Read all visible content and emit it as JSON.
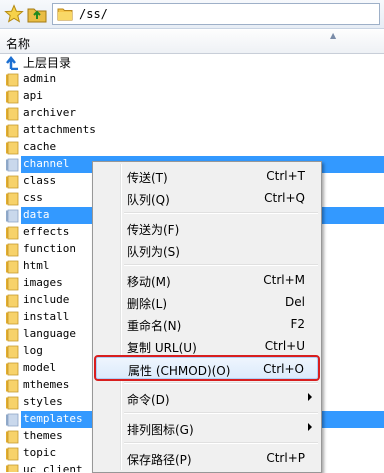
{
  "path_bar": {
    "path": "/ss/"
  },
  "column_header": {
    "name": "名称"
  },
  "files": [
    {
      "name": "上层目录",
      "kind": "parent",
      "selected": false
    },
    {
      "name": "admin",
      "kind": "folder",
      "selected": false
    },
    {
      "name": "api",
      "kind": "folder",
      "selected": false
    },
    {
      "name": "archiver",
      "kind": "folder",
      "selected": false
    },
    {
      "name": "attachments",
      "kind": "folder",
      "selected": false
    },
    {
      "name": "cache",
      "kind": "folder",
      "selected": false
    },
    {
      "name": "channel",
      "kind": "folder",
      "selected": true
    },
    {
      "name": "class",
      "kind": "folder",
      "selected": false
    },
    {
      "name": "css",
      "kind": "folder",
      "selected": false
    },
    {
      "name": "data",
      "kind": "folder",
      "selected": true
    },
    {
      "name": "effects",
      "kind": "folder",
      "selected": false
    },
    {
      "name": "function",
      "kind": "folder",
      "selected": false
    },
    {
      "name": "html",
      "kind": "folder",
      "selected": false
    },
    {
      "name": "images",
      "kind": "folder",
      "selected": false
    },
    {
      "name": "include",
      "kind": "folder",
      "selected": false
    },
    {
      "name": "install",
      "kind": "folder",
      "selected": false
    },
    {
      "name": "language",
      "kind": "folder",
      "selected": false
    },
    {
      "name": "log",
      "kind": "folder",
      "selected": false
    },
    {
      "name": "model",
      "kind": "folder",
      "selected": false
    },
    {
      "name": "mthemes",
      "kind": "folder",
      "selected": false
    },
    {
      "name": "styles",
      "kind": "folder",
      "selected": false
    },
    {
      "name": "templates",
      "kind": "folder",
      "selected": true
    },
    {
      "name": "themes",
      "kind": "folder",
      "selected": false
    },
    {
      "name": "topic",
      "kind": "folder",
      "selected": false
    },
    {
      "name": "uc_client",
      "kind": "folder",
      "selected": false
    }
  ],
  "context_menu": {
    "items": [
      {
        "label": "传送(T)",
        "shortcut": "Ctrl+T"
      },
      {
        "label": "队列(Q)",
        "shortcut": "Ctrl+Q"
      },
      {
        "separator": true
      },
      {
        "label": "传送为(F)",
        "shortcut": ""
      },
      {
        "label": "队列为(S)",
        "shortcut": ""
      },
      {
        "separator": true
      },
      {
        "label": "移动(M)",
        "shortcut": "Ctrl+M"
      },
      {
        "label": "删除(L)",
        "shortcut": "Del"
      },
      {
        "label": "重命名(N)",
        "shortcut": "F2"
      },
      {
        "label": "复制 URL(U)",
        "shortcut": "Ctrl+U"
      },
      {
        "label": "属性 (CHMOD)(O)",
        "shortcut": "Ctrl+O",
        "highlighted": true
      },
      {
        "separator": true
      },
      {
        "label": "命令(D)",
        "shortcut": "",
        "submenu": true
      },
      {
        "separator": true
      },
      {
        "label": "排列图标(G)",
        "shortcut": "",
        "submenu": true
      },
      {
        "separator": true
      },
      {
        "label": "保存路径(P)",
        "shortcut": "Ctrl+P"
      }
    ]
  },
  "colors": {
    "selection": "#3399ff",
    "highlight_box": "#d81e1e",
    "folder_yellow": "#f5c64a"
  }
}
